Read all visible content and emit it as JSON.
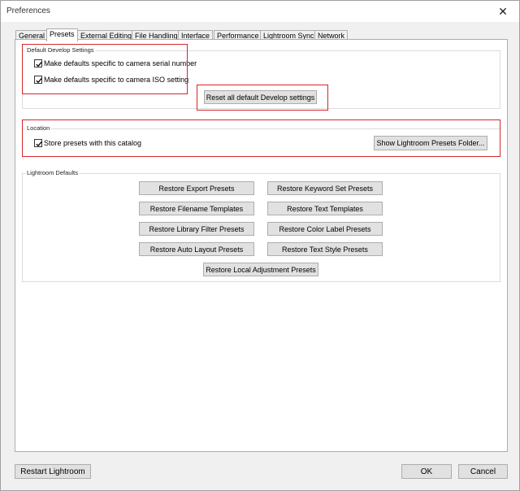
{
  "window": {
    "title": "Preferences",
    "close_glyph": "✕"
  },
  "tabs": [
    {
      "label": "General",
      "active": false
    },
    {
      "label": "Presets",
      "active": true
    },
    {
      "label": "External Editing",
      "active": false
    },
    {
      "label": "File Handling",
      "active": false
    },
    {
      "label": "Interface",
      "active": false
    },
    {
      "label": "Performance",
      "active": false
    },
    {
      "label": "Lightroom Sync",
      "active": false
    },
    {
      "label": "Network",
      "active": false
    }
  ],
  "default_develop": {
    "title": "Default Develop Settings",
    "serial_label": "Make defaults specific to camera serial number",
    "serial_checked": true,
    "iso_label": "Make defaults specific to camera ISO setting",
    "iso_checked": true,
    "reset_label": "Reset all default Develop settings"
  },
  "location": {
    "title": "Location",
    "store_label": "Store presets with this catalog",
    "store_checked": true,
    "show_folder_label": "Show Lightroom Presets Folder..."
  },
  "lightroom_defaults": {
    "title": "Lightroom Defaults",
    "buttons": [
      "Restore Export Presets",
      "Restore Keyword Set Presets",
      "Restore Filename Templates",
      "Restore Text Templates",
      "Restore Library Filter Presets",
      "Restore Color Label Presets",
      "Restore Auto Layout Presets",
      "Restore Text Style Presets",
      "Restore Local Adjustment Presets"
    ]
  },
  "footer": {
    "restart_label": "Restart Lightroom",
    "ok_label": "OK",
    "cancel_label": "Cancel"
  }
}
